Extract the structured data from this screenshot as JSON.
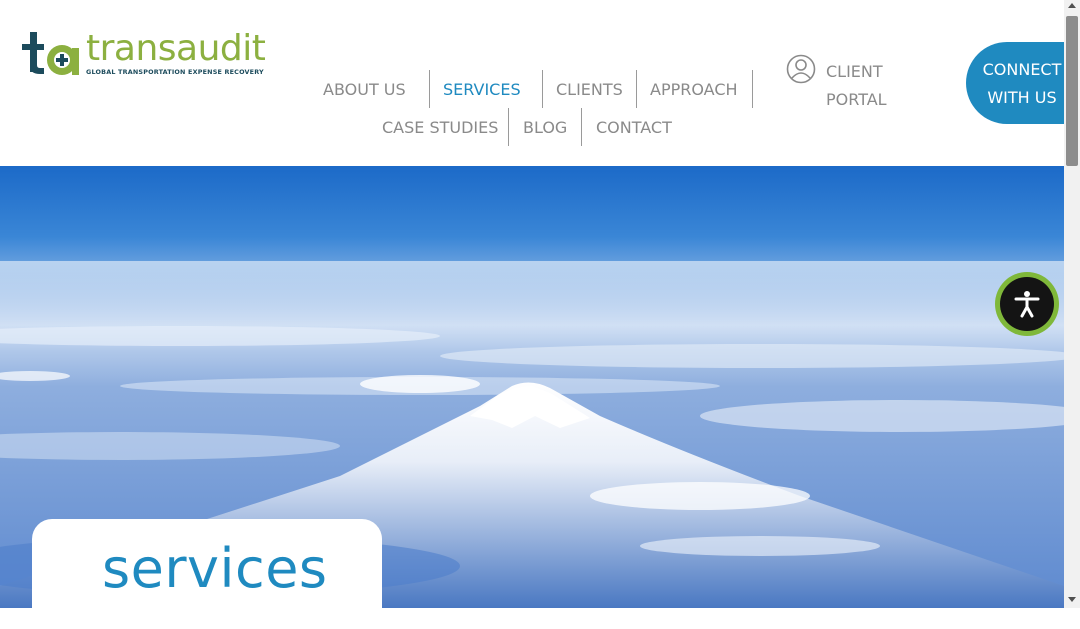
{
  "brand": {
    "wordmark": "transaudit",
    "tagline": "GLOBAL TRANSPORTATION EXPENSE RECOVERY",
    "colors": {
      "green": "#8cb040",
      "navy": "#1c4b5c",
      "blue": "#1f8ac0"
    }
  },
  "nav": {
    "items": [
      {
        "label": "ABOUT US"
      },
      {
        "label": "SERVICES",
        "active": true
      },
      {
        "label": "CLIENTS"
      },
      {
        "label": "APPROACH"
      },
      {
        "label": "CASE STUDIES"
      },
      {
        "label": "BLOG"
      },
      {
        "label": "CONTACT"
      }
    ],
    "client_portal": {
      "line1": "CLIENT",
      "line2": "PORTAL",
      "icon": "user-circle-icon"
    },
    "cta": {
      "line1": "CONNECT",
      "line2": "WITH US"
    }
  },
  "hero": {
    "image": "aerial view of a snow-capped mountain above clouds",
    "title": "services"
  },
  "accessibility": {
    "icon": "accessibility-icon",
    "color": "#7fb83a"
  }
}
